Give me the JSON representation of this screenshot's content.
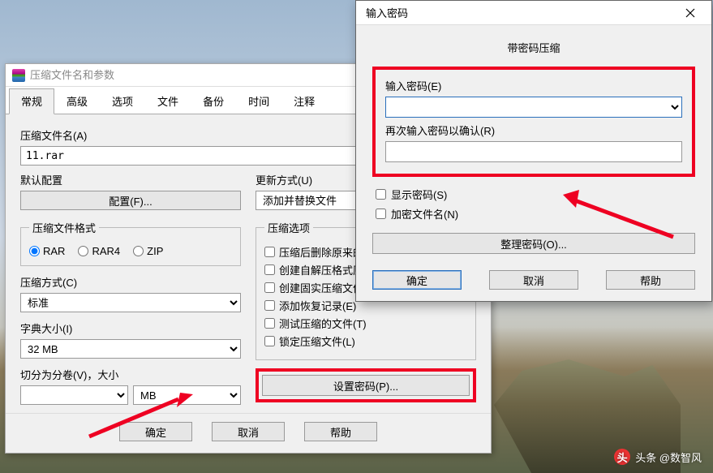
{
  "main_dialog": {
    "title": "压缩文件名和参数",
    "tabs": [
      "常规",
      "高级",
      "选项",
      "文件",
      "备份",
      "时间",
      "注释"
    ],
    "archive_name_label": "压缩文件名(A)",
    "archive_name_value": "11.rar",
    "default_profile_label": "默认配置",
    "profile_button": "配置(F)...",
    "update_mode_label": "更新方式(U)",
    "update_mode_value": "添加并替换文件",
    "format_label": "压缩文件格式",
    "formats": [
      "RAR",
      "RAR4",
      "ZIP"
    ],
    "method_label": "压缩方式(C)",
    "method_value": "标准",
    "dict_label": "字典大小(I)",
    "dict_value": "32 MB",
    "split_label": "切分为分卷(V)，大小",
    "split_unit": "MB",
    "options_label": "压缩选项",
    "options": [
      "压缩后删除原来的文",
      "创建自解压格式压缩",
      "创建固实压缩文件(",
      "添加恢复记录(E)",
      "测试压缩的文件(T)",
      "锁定压缩文件(L)"
    ],
    "set_password_button": "设置密码(P)...",
    "ok": "确定",
    "cancel": "取消",
    "help": "帮助"
  },
  "pwd_dialog": {
    "title": "输入密码",
    "heading": "带密码压缩",
    "enter_label": "输入密码(E)",
    "confirm_label": "再次输入密码以确认(R)",
    "show_password": "显示密码(S)",
    "encrypt_names": "加密文件名(N)",
    "organize": "整理密码(O)...",
    "ok": "确定",
    "cancel": "取消",
    "help": "帮助"
  },
  "watermark": "头条 @数智风"
}
